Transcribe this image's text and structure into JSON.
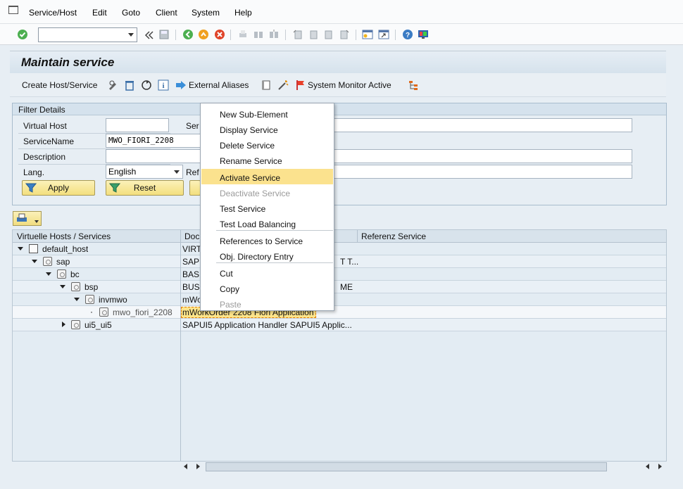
{
  "menubar": {
    "items": [
      "Service/Host",
      "Edit",
      "Goto",
      "Client",
      "System",
      "Help"
    ]
  },
  "toolbar": {
    "command_field_value": "",
    "icons": [
      "enter-icon",
      "back-icon",
      "save-icon",
      "exit-icon",
      "cancel-icon",
      "print-icon",
      "find-icon",
      "find-next-icon",
      "first-page-icon",
      "prev-page-icon",
      "next-page-icon",
      "last-page-icon",
      "create-session-icon",
      "shortcut-icon",
      "help-icon",
      "customize-layout-icon"
    ]
  },
  "screen": {
    "title": "Maintain service"
  },
  "app_toolbar": {
    "create_label": "Create Host/Service",
    "external_aliases_label": "External Aliases",
    "system_monitor_label": "System Monitor Active"
  },
  "filter": {
    "header": "Filter Details",
    "virtual_host_label": "Virtual Host",
    "virtual_host_value": "",
    "service_label": "Ser",
    "service_value": "",
    "service_name_label": "ServiceName",
    "service_name_value": "MWO_FIORI_2208",
    "description_label": "Description",
    "description_value": "",
    "lang_label": "Lang.",
    "lang_value": "English",
    "ref_label": "Ref",
    "ref_value": "",
    "apply_label": "Apply",
    "reset_label": "Reset"
  },
  "tree": {
    "columns": [
      "Virtuelle Hosts / Services",
      "Doc",
      "Referenz Service"
    ],
    "rows": [
      {
        "name": "default_host",
        "doc": "VIRT"
      },
      {
        "name": "sap",
        "doc": "SAP",
        "doc_tail": "T T..."
      },
      {
        "name": "bc",
        "doc": "BASI"
      },
      {
        "name": "bsp",
        "doc": "BUSI",
        "doc_tail": "ME"
      },
      {
        "name": "invmwo",
        "doc": "mWo"
      },
      {
        "name": "mwo_fiori_2208",
        "doc": "mWorkOrder 2208 Fiori Application"
      },
      {
        "name": "ui5_ui5",
        "doc": "SAPUI5 Application Handler SAPUI5 Applic..."
      }
    ]
  },
  "context_menu": {
    "items": [
      {
        "label": "New Sub-Element",
        "disabled": false
      },
      {
        "label": "Display Service",
        "disabled": false
      },
      {
        "label": "Delete Service",
        "disabled": false
      },
      {
        "label": "Rename Service",
        "disabled": false
      },
      {
        "label": "Activate Service",
        "disabled": false,
        "highlighted": true
      },
      {
        "label": "Deactivate Service",
        "disabled": true
      },
      {
        "label": "Test Service",
        "disabled": false
      },
      {
        "label": "Test Load Balancing",
        "disabled": false
      },
      {
        "label": "References to Service",
        "disabled": false
      },
      {
        "label": "Obj. Directory Entry",
        "disabled": false
      },
      {
        "label": "Cut",
        "disabled": false
      },
      {
        "label": "Copy",
        "disabled": false
      },
      {
        "label": "Paste",
        "disabled": true
      }
    ]
  },
  "colors": {
    "highlight": "#fbe28e",
    "button_yellow": "#f3df7e",
    "background": "#e7eef4"
  }
}
